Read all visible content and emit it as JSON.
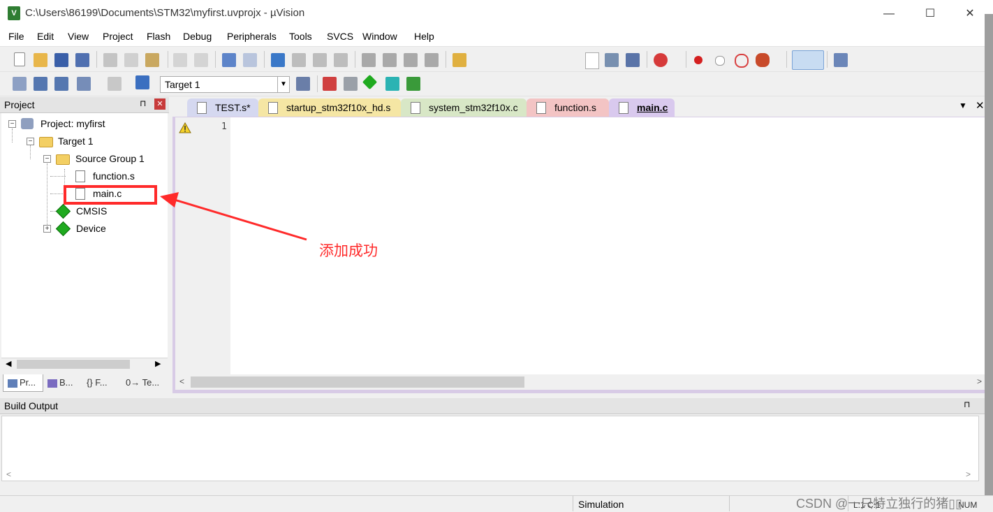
{
  "window": {
    "title": "C:\\Users\\86199\\Documents\\STM32\\myfirst.uvprojx - µVision",
    "minimize": "—",
    "maximize": "☐",
    "close": "✕"
  },
  "menu": [
    "File",
    "Edit",
    "View",
    "Project",
    "Flash",
    "Debug",
    "Peripherals",
    "Tools",
    "SVCS",
    "Window",
    "Help"
  ],
  "toolbar2": {
    "target_select": "Target 1"
  },
  "project_panel": {
    "title": "Project",
    "pin": "⊓",
    "close": "✕",
    "tree": {
      "project": "Project: myfirst",
      "target": "Target 1",
      "group": "Source Group 1",
      "files": [
        "function.s",
        "main.c"
      ],
      "cmsis": "CMSIS",
      "device": "Device"
    },
    "tabs": [
      "Pr...",
      "B...",
      "{} F...",
      "0→ Te..."
    ]
  },
  "editor": {
    "tabs": [
      "TEST.s*",
      "startup_stm32f10x_hd.s",
      "system_stm32f10x.c",
      "function.s",
      "main.c"
    ],
    "active_tab": "main.c",
    "line_number": "1",
    "tab_colors": [
      "#d5d8f0",
      "#f5e6a4",
      "#d8e7c6",
      "#f3c4c4",
      "#d9c9ee"
    ]
  },
  "build_output": {
    "title": "Build Output"
  },
  "status": {
    "mode": "Simulation",
    "position": "L:1 C:1",
    "num": "NUM"
  },
  "annotation": {
    "text": "添加成功",
    "color": "#ff2a2a"
  },
  "watermark": "CSDN @一只特立独行的猪▯▯"
}
